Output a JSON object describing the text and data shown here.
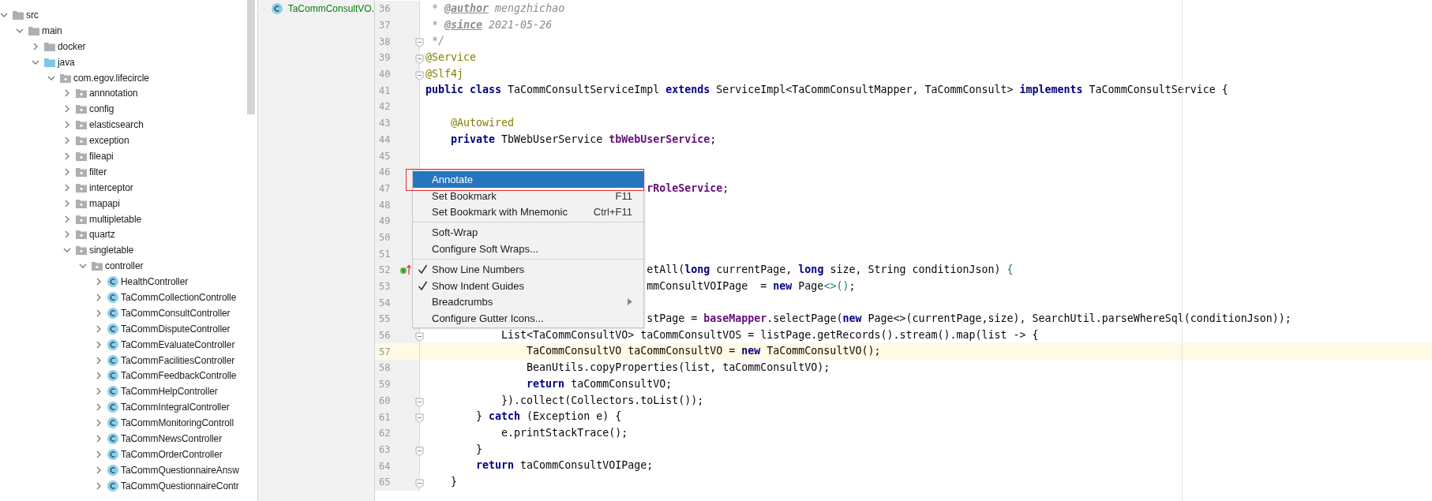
{
  "tree": {
    "items": [
      {
        "label": "src",
        "kind": "folder",
        "expanded": true,
        "children": [
          {
            "label": "main",
            "kind": "folder",
            "expanded": true,
            "children": [
              {
                "label": "docker",
                "kind": "folder",
                "expanded": false
              },
              {
                "label": "java",
                "kind": "source",
                "expanded": true,
                "children": [
                  {
                    "label": "com.egov.lifecircle",
                    "kind": "package",
                    "expanded": true,
                    "children": [
                      {
                        "label": "annnotation",
                        "kind": "package",
                        "expanded": false
                      },
                      {
                        "label": "config",
                        "kind": "package",
                        "expanded": false
                      },
                      {
                        "label": "elasticsearch",
                        "kind": "package",
                        "expanded": false
                      },
                      {
                        "label": "exception",
                        "kind": "package",
                        "expanded": false
                      },
                      {
                        "label": "fileapi",
                        "kind": "package",
                        "expanded": false
                      },
                      {
                        "label": "filter",
                        "kind": "package",
                        "expanded": false
                      },
                      {
                        "label": "interceptor",
                        "kind": "package",
                        "expanded": false
                      },
                      {
                        "label": "mapapi",
                        "kind": "package",
                        "expanded": false
                      },
                      {
                        "label": "multipletable",
                        "kind": "package",
                        "expanded": false
                      },
                      {
                        "label": "quartz",
                        "kind": "package",
                        "expanded": false
                      },
                      {
                        "label": "singletable",
                        "kind": "package",
                        "expanded": true,
                        "children": [
                          {
                            "label": "controller",
                            "kind": "package",
                            "expanded": true,
                            "children": [
                              {
                                "label": "HealthController",
                                "kind": "class",
                                "expanded": false
                              },
                              {
                                "label": "TaCommCollectionControlle",
                                "kind": "class",
                                "expanded": false
                              },
                              {
                                "label": "TaCommConsultController",
                                "kind": "class",
                                "expanded": false
                              },
                              {
                                "label": "TaCommDisputeController",
                                "kind": "class",
                                "expanded": false
                              },
                              {
                                "label": "TaCommEvaluateController",
                                "kind": "class",
                                "expanded": false
                              },
                              {
                                "label": "TaCommFacilitiesController",
                                "kind": "class",
                                "expanded": false
                              },
                              {
                                "label": "TaCommFeedbackControlle",
                                "kind": "class",
                                "expanded": false
                              },
                              {
                                "label": "TaCommHelpController",
                                "kind": "class",
                                "expanded": false
                              },
                              {
                                "label": "TaCommIntegralController",
                                "kind": "class",
                                "expanded": false
                              },
                              {
                                "label": "TaCommMonitoringControll",
                                "kind": "class",
                                "expanded": false
                              },
                              {
                                "label": "TaCommNewsController",
                                "kind": "class",
                                "expanded": false
                              },
                              {
                                "label": "TaCommOrderController",
                                "kind": "class",
                                "expanded": false
                              },
                              {
                                "label": "TaCommQuestionnaireAnsw",
                                "kind": "class",
                                "expanded": false
                              },
                              {
                                "label": "TaCommQuestionnaireContr",
                                "kind": "class",
                                "expanded": false
                              }
                            ]
                          }
                        ]
                      }
                    ]
                  }
                ]
              }
            ]
          }
        ]
      }
    ]
  },
  "tabs": [
    {
      "label": "TaCommConsultVO.",
      "kind": "class",
      "color": "#0a7f0a",
      "selected": true
    }
  ],
  "editor": {
    "lines": [
      {
        "number": "36",
        "tokens": [
          {
            "text": " * ",
            "kind": "comment"
          },
          {
            "text": "@author",
            "kind": "doctag"
          },
          {
            "text": " mengzhichao",
            "kind": "comment"
          }
        ]
      },
      {
        "number": "37",
        "tokens": [
          {
            "text": " * ",
            "kind": "comment"
          },
          {
            "text": "@since",
            "kind": "doctag"
          },
          {
            "text": " 2021-05-26",
            "kind": "comment"
          }
        ]
      },
      {
        "number": "38",
        "fold": true,
        "tokens": [
          {
            "text": " */",
            "kind": "comment"
          }
        ]
      },
      {
        "number": "39",
        "fold": true,
        "tokens": [
          {
            "text": "@Service",
            "kind": "annotation"
          }
        ]
      },
      {
        "number": "40",
        "fold": true,
        "tokens": [
          {
            "text": "@Slf4j",
            "kind": "annotation"
          }
        ]
      },
      {
        "number": "41",
        "tokens": [
          {
            "text": "public class",
            "kind": "keyword"
          },
          {
            "text": " TaCommConsultServiceImpl ",
            "kind": "plain"
          },
          {
            "text": "extends",
            "kind": "keyword"
          },
          {
            "text": " ServiceImpl<TaCommConsultMapper, TaCommConsult> ",
            "kind": "plain"
          },
          {
            "text": "implements",
            "kind": "keyword"
          },
          {
            "text": " TaCommConsultService {",
            "kind": "plain"
          }
        ]
      },
      {
        "number": "42"
      },
      {
        "number": "43",
        "tokens": [
          {
            "text": "    @Autowired",
            "kind": "annotation"
          }
        ]
      },
      {
        "number": "44",
        "tokens": [
          {
            "text": "    private",
            "kind": "keyword"
          },
          {
            "text": " TbWebUserService ",
            "kind": "plain"
          },
          {
            "text": "tbWebUserService",
            "kind": "field"
          },
          {
            "text": ";",
            "kind": "plain"
          }
        ]
      },
      {
        "number": "45"
      },
      {
        "number": "46"
      },
      {
        "number": "47",
        "tokens": [
          {
            "text": "                                   rRoleService",
            "kind": "field"
          },
          {
            "text": ";",
            "kind": "plain"
          }
        ]
      },
      {
        "number": "48"
      },
      {
        "number": "49"
      },
      {
        "number": "50"
      },
      {
        "number": "51"
      },
      {
        "number": "52",
        "marker": true,
        "tokens": [
          {
            "text": "                                   etAll(",
            "kind": "plain"
          },
          {
            "text": "long",
            "kind": "keyword"
          },
          {
            "text": " currentPage, ",
            "kind": "plain"
          },
          {
            "text": "long",
            "kind": "keyword"
          },
          {
            "text": " size, String conditionJson) ",
            "kind": "plain"
          },
          {
            "text": "{",
            "kind": "bracket"
          }
        ]
      },
      {
        "number": "53",
        "tokens": [
          {
            "text": "                                   mmConsultVOIPage  = ",
            "kind": "plain"
          },
          {
            "text": "new",
            "kind": "keyword"
          },
          {
            "text": " Page",
            "kind": "plain"
          },
          {
            "text": "<>()",
            "kind": "bracket"
          },
          {
            "text": ";",
            "kind": "plain"
          }
        ]
      },
      {
        "number": "54"
      },
      {
        "number": "55",
        "tokens": [
          {
            "text": "                                   stPage = ",
            "kind": "plain"
          },
          {
            "text": "baseMapper",
            "kind": "field"
          },
          {
            "text": ".selectPage(",
            "kind": "plain"
          },
          {
            "text": "new",
            "kind": "keyword"
          },
          {
            "text": " Page<>(currentPage,size), SearchUtil.parseWhereSql(conditionJson));",
            "kind": "plain"
          }
        ]
      },
      {
        "number": "56",
        "fold": true,
        "tokens": [
          {
            "text": "            List<TaCommConsultVO> taCommConsultVOS = listPage.getRecords().stream().map(list -> {",
            "kind": "plain"
          }
        ]
      },
      {
        "number": "57",
        "current": true,
        "tokens": [
          {
            "text": "                TaCommConsultVO taCommConsultVO = ",
            "kind": "plain"
          },
          {
            "text": "new",
            "kind": "keyword"
          },
          {
            "text": " TaCommConsultVO();",
            "kind": "plain"
          }
        ]
      },
      {
        "number": "58",
        "tokens": [
          {
            "text": "                BeanUtils.copyProperties(list, taCommConsultVO);",
            "kind": "plain"
          }
        ]
      },
      {
        "number": "59",
        "tokens": [
          {
            "text": "                return",
            "kind": "keyword"
          },
          {
            "text": " taCommConsultVO;",
            "kind": "plain"
          }
        ]
      },
      {
        "number": "60",
        "fold": true,
        "tokens": [
          {
            "text": "            }).collect(Collectors.toList());",
            "kind": "plain"
          }
        ]
      },
      {
        "number": "61",
        "fold": true,
        "tokens": [
          {
            "text": "        } ",
            "kind": "plain"
          },
          {
            "text": "catch",
            "kind": "keyword"
          },
          {
            "text": " (Exception e) {",
            "kind": "plain"
          }
        ]
      },
      {
        "number": "62",
        "tokens": [
          {
            "text": "            e.printStackTrace();",
            "kind": "plain"
          }
        ]
      },
      {
        "number": "63",
        "fold": true,
        "tokens": [
          {
            "text": "        }",
            "kind": "plain"
          }
        ]
      },
      {
        "number": "64",
        "tokens": [
          {
            "text": "        return",
            "kind": "keyword"
          },
          {
            "text": " taCommConsultVOIPage;",
            "kind": "plain"
          }
        ]
      },
      {
        "number": "65",
        "fold": true,
        "tokens": [
          {
            "text": "    }",
            "kind": "plain"
          }
        ]
      }
    ]
  },
  "context_menu": {
    "items": [
      {
        "kind": "item",
        "label": "Annotate",
        "selected": true,
        "checked": false,
        "submenu": false,
        "outlined": true
      },
      {
        "kind": "item",
        "label": "Set Bookmark",
        "shortcut": "F11",
        "selected": false,
        "checked": false,
        "submenu": false,
        "outlined": false
      },
      {
        "kind": "item",
        "label": "Set Bookmark with Mnemonic",
        "shortcut": "Ctrl+F11",
        "selected": false,
        "checked": false,
        "submenu": false,
        "outlined": false
      },
      {
        "kind": "separator"
      },
      {
        "kind": "item",
        "label": "Soft-Wrap",
        "selected": false,
        "checked": false,
        "submenu": false,
        "outlined": false
      },
      {
        "kind": "item",
        "label": "Configure Soft Wraps...",
        "selected": false,
        "checked": false,
        "submenu": false,
        "outlined": false
      },
      {
        "kind": "separator"
      },
      {
        "kind": "item",
        "label": "Show Line Numbers",
        "selected": false,
        "checked": true,
        "submenu": false,
        "outlined": false
      },
      {
        "kind": "item",
        "label": "Show Indent Guides",
        "selected": false,
        "checked": true,
        "submenu": false,
        "outlined": false
      },
      {
        "kind": "item",
        "label": "Breadcrumbs",
        "selected": false,
        "checked": false,
        "submenu": true,
        "outlined": false
      },
      {
        "kind": "item",
        "label": "Configure Gutter Icons...",
        "selected": false,
        "checked": false,
        "submenu": false,
        "outlined": false
      }
    ]
  }
}
